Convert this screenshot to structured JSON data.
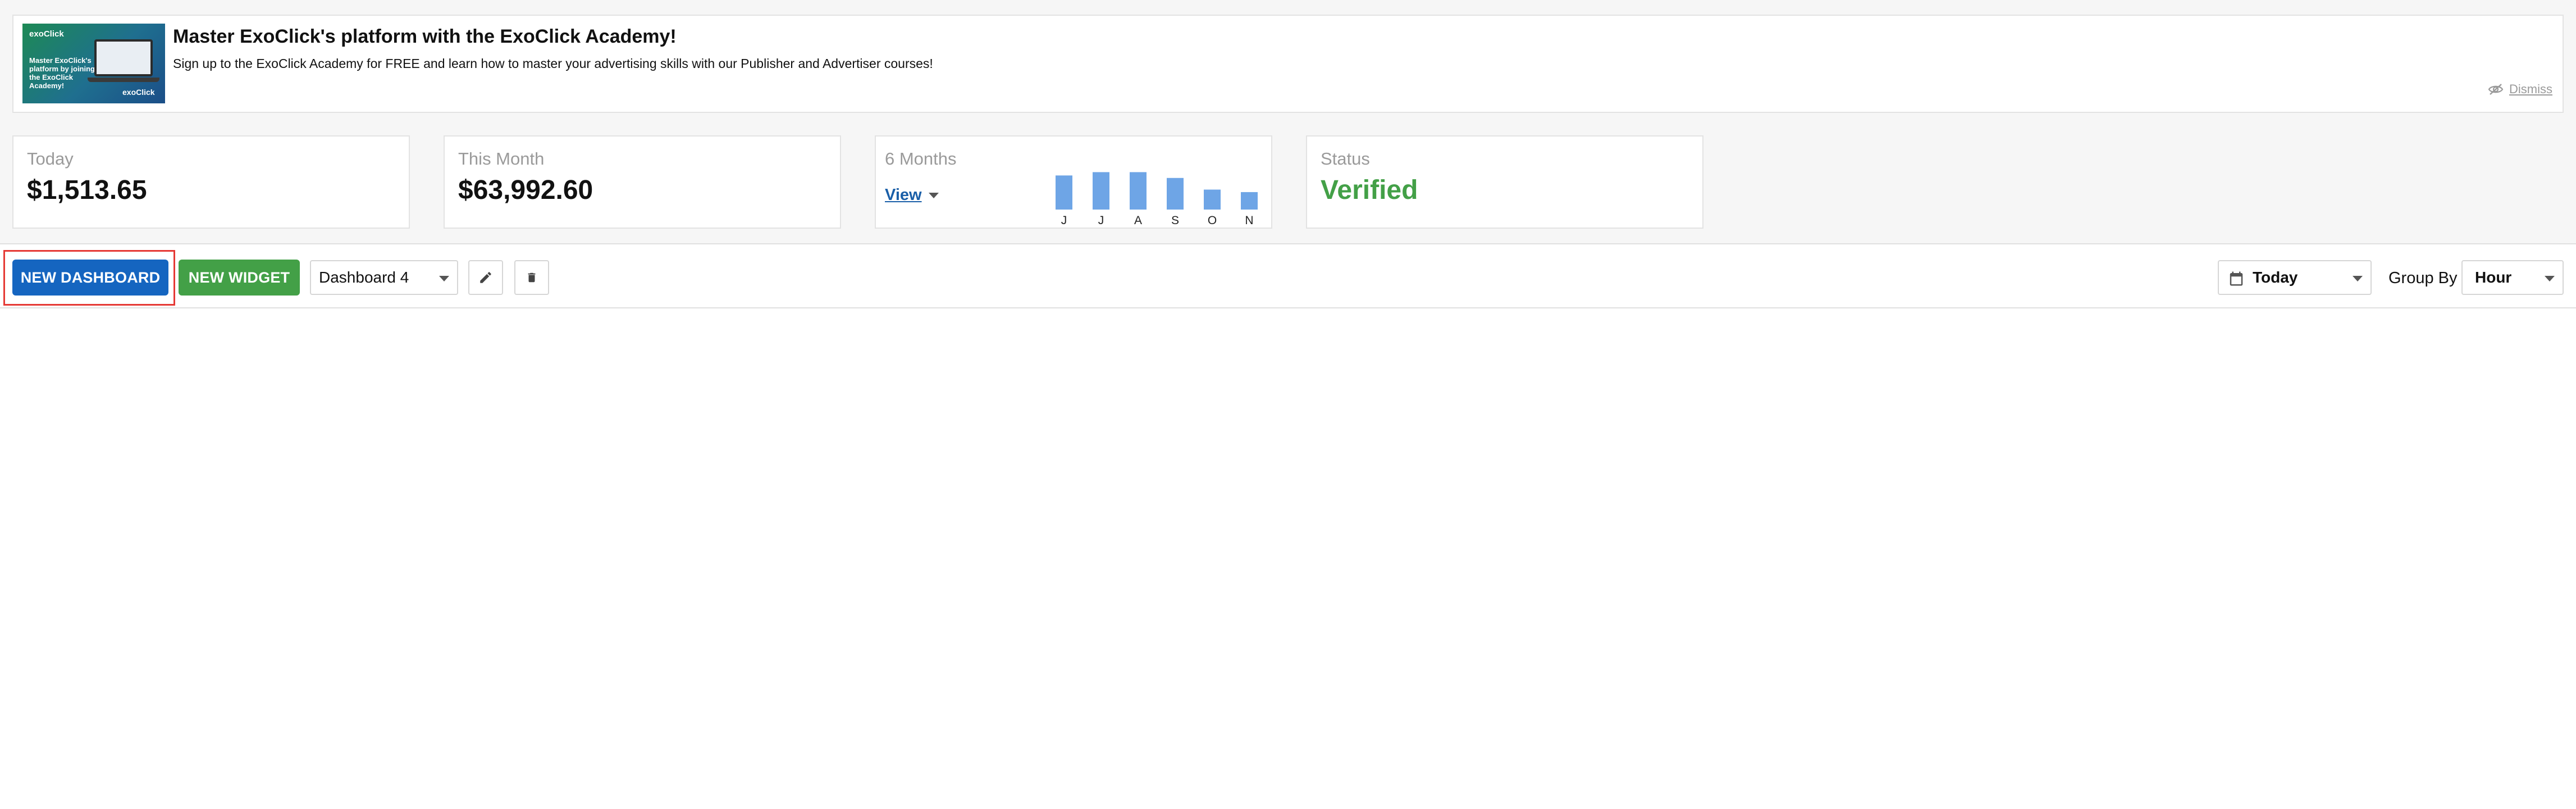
{
  "banner": {
    "thumbnail": {
      "logo": "exoClick",
      "text": "Master ExoClick's platform by joining the ExoClick Academy!",
      "logo2": "exoClick"
    },
    "title": "Master ExoClick's platform with the ExoClick Academy!",
    "subtitle": "Sign up to the ExoClick Academy for FREE and learn how to master your advertising skills with our Publisher and Advertiser courses!",
    "dismiss_label": "Dismiss",
    "dismiss_icon": "eye-slash-icon"
  },
  "stats": {
    "today": {
      "label": "Today",
      "value": "$1,513.65"
    },
    "this_month": {
      "label": "This Month",
      "value": "$63,992.60"
    },
    "six_months": {
      "label": "6 Months",
      "view_label": "View",
      "chart_data": {
        "type": "bar",
        "categories": [
          "J",
          "J",
          "A",
          "S",
          "O",
          "N"
        ],
        "values": [
          0.82,
          0.9,
          0.9,
          0.76,
          0.48,
          0.42
        ],
        "ylim": [
          0,
          1
        ],
        "color": "#6ea5e6"
      }
    },
    "status": {
      "label": "Status",
      "value": "Verified",
      "color": "#43a047"
    }
  },
  "toolbar": {
    "new_dashboard_label": "NEW DASHBOARD",
    "new_widget_label": "NEW WIDGET",
    "dashboard_select": "Dashboard 4",
    "edit_icon": "pencil-icon",
    "delete_icon": "trash-icon",
    "date_range": "Today",
    "date_icon": "calendar-icon",
    "group_by_label": "Group By",
    "group_by_value": "Hour"
  },
  "colors": {
    "primary": "#1565c0",
    "success": "#43a047",
    "highlight": "#e53935"
  }
}
